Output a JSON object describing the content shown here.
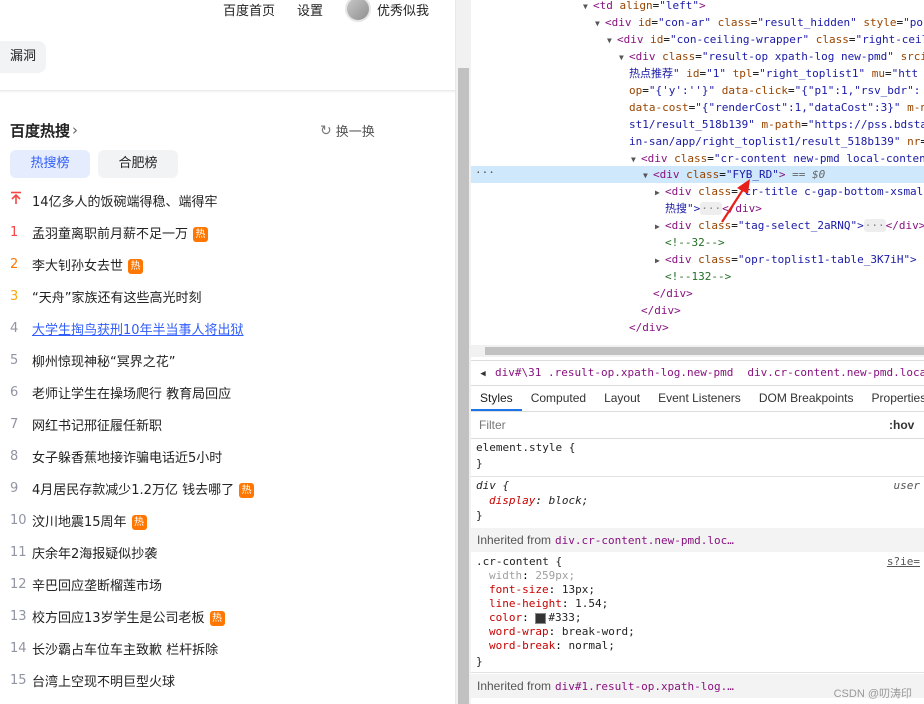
{
  "left_pane": {
    "top_nav": {
      "home": "百度首页",
      "settings": "设置",
      "user_name": "优秀似我"
    },
    "vuln_tag": "漏洞",
    "hot_search": {
      "title": "百度热搜",
      "chevron": "›",
      "refresh_label": "换一换",
      "tabs": [
        "热搜榜",
        "合肥榜"
      ],
      "items": [
        {
          "rank": "",
          "title": "14亿多人的饭碗端得稳、端得牢",
          "hot": false
        },
        {
          "rank": "1",
          "title": "孟羽童离职前月薪不足一万",
          "hot": true
        },
        {
          "rank": "2",
          "title": "李大钊孙女去世",
          "hot": true
        },
        {
          "rank": "3",
          "title": "“天舟”家族还有这些高光时刻",
          "hot": false
        },
        {
          "rank": "4",
          "title": "大学生掏鸟获刑10年半当事人将出狱",
          "hot": false
        },
        {
          "rank": "5",
          "title": "柳州惊现神秘“冥界之花”",
          "hot": false
        },
        {
          "rank": "6",
          "title": "老师让学生在操场爬行 教育局回应",
          "hot": false
        },
        {
          "rank": "7",
          "title": "网红书记邢征履任新职",
          "hot": false
        },
        {
          "rank": "8",
          "title": "女子躲香蕉地接诈骗电话近5小时",
          "hot": false
        },
        {
          "rank": "9",
          "title": "4月居民存款减少1.2万亿 钱去哪了",
          "hot": true
        },
        {
          "rank": "10",
          "title": "汶川地震15周年",
          "hot": true
        },
        {
          "rank": "11",
          "title": "庆余年2海报疑似抄袭",
          "hot": false
        },
        {
          "rank": "12",
          "title": "辛巴回应垄断榴莲市场",
          "hot": false
        },
        {
          "rank": "13",
          "title": "校方回应13岁学生是公司老板",
          "hot": true
        },
        {
          "rank": "14",
          "title": "长沙霸占车位车主致歉 栏杆拆除",
          "hot": false
        },
        {
          "rank": "15",
          "title": "台湾上空现不明巨型火球",
          "hot": false
        }
      ],
      "hot_badge": "热",
      "top_icon": "pin-top-icon"
    }
  },
  "devtools": {
    "elements": {
      "l1": {
        "open": "<td",
        "attr": "align",
        "val": "\"left\"",
        "close": ">"
      },
      "l2": {
        "open": "<div",
        "a1": "id",
        "v1": "\"con-ar\"",
        "a2": "class",
        "v2": "\"result_hidden\"",
        "a3": "style",
        "v3": "\"po"
      },
      "l3": {
        "open": "<div",
        "a1": "id",
        "v1": "\"con-ceiling-wrapper\"",
        "a2": "class",
        "v2": "\"right-ceil"
      },
      "l4": {
        "open": "<div",
        "a1": "class",
        "v1": "\"result-op xpath-log new-pmd\"",
        "a2": "srcid"
      },
      "l5": {
        "text": "热点推荐\"",
        "a1": "id",
        "v1": "\"1\"",
        "a2": "tpl",
        "v2": "\"right_toplist1\"",
        "a3": "mu",
        "v3": "\"htt"
      },
      "l6": {
        "a1": "op",
        "v1": "\"{'y':''}\"",
        "a2": "data-click",
        "v2": "\"{\"p1\":1,\"rsv_bdr\":"
      },
      "l7": {
        "a1": "data-cost",
        "v1": "\"{\"renderCost\":1,\"dataCost\":3}\"",
        "a2": "m-n"
      },
      "l8": {
        "v1": "st1/result_518b139\"",
        "a2": "m-path",
        "v2": "\"https://pss.bdsta"
      },
      "l9": {
        "v1": "in-san/app/right_toplist1/result_518b139\"",
        "a2": "nr"
      },
      "l10": {
        "open": "<div",
        "a1": "class",
        "v1": "\"cr-content new-pmd local-conten"
      },
      "l11": {
        "open": "<div",
        "a1": "class",
        "v1": "\"FYB_RD\"",
        "close": ">",
        "eq": "== $0"
      },
      "l12": {
        "open": "<div",
        "a1": "class",
        "v1": "\"cr-title c-gap-bottom-xsmal"
      },
      "l13": {
        "text": "热搜\">",
        "close": "</div>"
      },
      "l14": {
        "open": "<div",
        "a1": "class",
        "v1": "\"tag-select_2aRNQ\">",
        "close": "</div>"
      },
      "l15": {
        "comment": "<!--32-->"
      },
      "l16": {
        "open": "<div",
        "a1": "class",
        "v1": "\"opr-toplist1-table_3K7iH\">"
      },
      "l17": {
        "comment": "<!--132-->"
      },
      "l18": {
        "close": "</div>"
      },
      "l19": {
        "close": "</div>"
      },
      "l20": {
        "close": "</div>"
      },
      "selected_dots": "···",
      "ellipsis": "···"
    },
    "breadcrumbs": [
      "div#\\31 .result-op.xpath-log.new-pmd",
      "div.cr-content.new-pmd.local-content_"
    ],
    "tabs": [
      "Styles",
      "Computed",
      "Layout",
      "Event Listeners",
      "DOM Breakpoints",
      "Properties"
    ],
    "filter_placeholder": "Filter",
    "hov": ":hov",
    "styles": {
      "r1_sel": "element.style {",
      "r1_close": "}",
      "r2_sel": "div {",
      "r2_src": "user",
      "r2_prop": "display",
      "r2_val": "block;",
      "r2_close": "}",
      "inh1_label": "Inherited from",
      "inh1_sel": "div.cr-content.new-pmd.loc…",
      "r3_sel": ".cr-content {",
      "r3_src": "s?ie=",
      "r3_props": [
        {
          "name": "width",
          "value": "259px;",
          "dim": true
        },
        {
          "name": "font-size",
          "value": "13px;",
          "dim": false
        },
        {
          "name": "line-height",
          "value": "1.54;",
          "dim": false
        },
        {
          "name": "color",
          "value": "#333;",
          "dim": false,
          "swatch": "#333333"
        },
        {
          "name": "word-wrap",
          "value": "break-word;",
          "dim": false
        },
        {
          "name": "word-break",
          "value": "normal;",
          "dim": false
        }
      ],
      "r3_close": "}",
      "inh2_label": "Inherited from",
      "inh2_sel": "div#1.result-op.xpath-log.…"
    },
    "watermark": "CSDN @叨涛印"
  },
  "colors": {
    "accent_blue": "#315efb",
    "hot_orange": "#ff7700",
    "rank_red": "#f54545",
    "annotation_red": "#e8201a"
  }
}
